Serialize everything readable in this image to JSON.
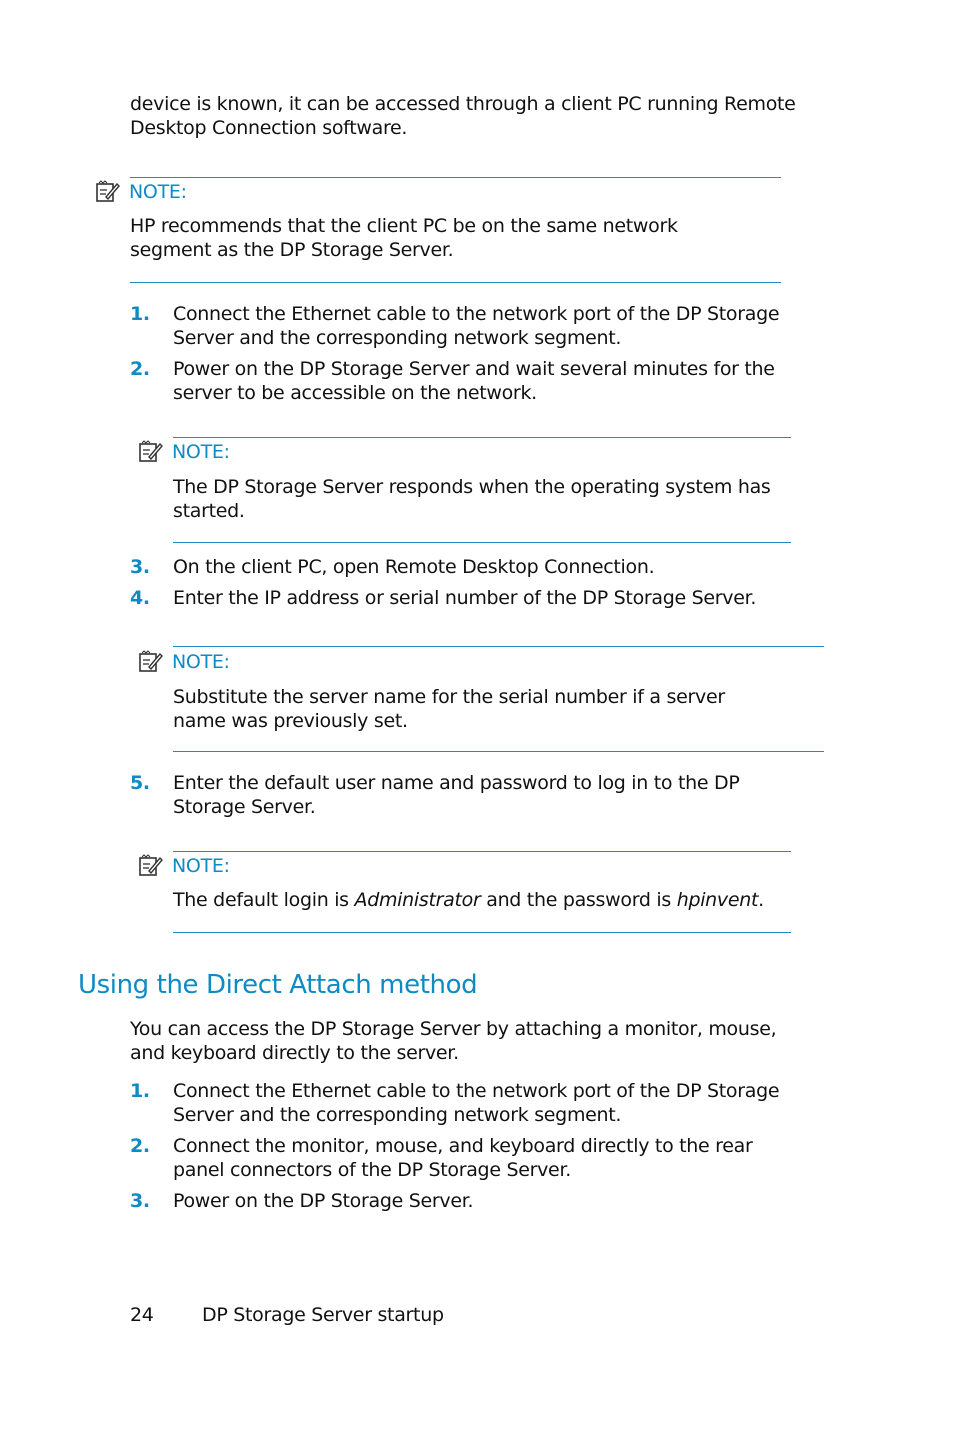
{
  "intro": {
    "line": "device is known, it can be accessed through a client PC running Remote Desktop Connection software."
  },
  "notes": [
    {
      "label": "NOTE:",
      "text": "HP recommends that the client PC be on the same network segment as the DP Storage Server."
    },
    {
      "label": "NOTE:",
      "text": "The DP Storage Server responds when the operating system has started."
    },
    {
      "label": "NOTE:",
      "text": "Substitute the server name for the serial number if a server name was previously set."
    },
    {
      "label": "NOTE:",
      "text_before": "The default login is ",
      "italic1": "Administrator",
      "text_middle": " and the password is ",
      "italic2": "hpinvent",
      "text_after": "."
    }
  ],
  "steps_remote": [
    {
      "num": "1.",
      "text": "Connect the Ethernet cable to the network port of the DP Storage Server and the corresponding network segment."
    },
    {
      "num": "2.",
      "text": "Power on the DP Storage Server and wait several minutes for the server to be accessible on the network."
    },
    {
      "num": "3.",
      "text": "On the client PC, open Remote Desktop Connection."
    },
    {
      "num": "4.",
      "text": "Enter the IP address or serial number of the DP Storage Server."
    },
    {
      "num": "5.",
      "text": "Enter the default user name and password to log in to the DP Storage Server."
    }
  ],
  "section": {
    "heading": "Using the Direct Attach method",
    "intro": "You can access the DP Storage Server by attaching a monitor, mouse, and keyboard directly to the server.",
    "steps": [
      {
        "num": "1.",
        "text": "Connect the Ethernet cable to the network port of the DP Storage Server and the corresponding network segment."
      },
      {
        "num": "2.",
        "text": "Connect the monitor, mouse, and keyboard directly to the rear panel connectors of the DP Storage Server."
      },
      {
        "num": "3.",
        "text": "Power on the DP Storage Server."
      }
    ]
  },
  "footer": {
    "page_number": "24",
    "chapter_title": "DP Storage Server startup"
  },
  "colors": {
    "accent": "#0e8bc4",
    "text": "#111111"
  }
}
